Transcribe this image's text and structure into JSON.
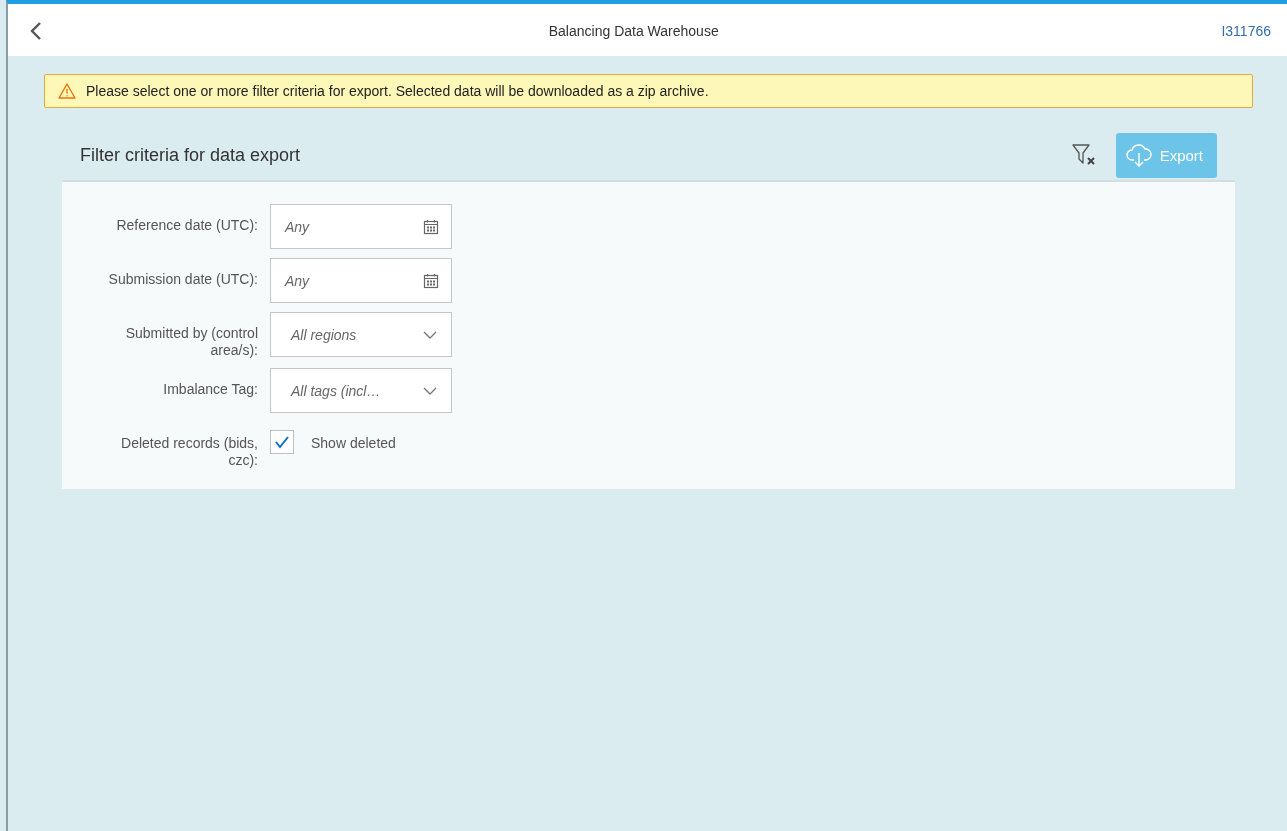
{
  "header": {
    "title": "Balancing Data Warehouse",
    "user": "I311766"
  },
  "message": {
    "kind": "warning",
    "text": "Please select one or more filter criteria for export. Selected data will be downloaded as a zip archive."
  },
  "panel": {
    "title": "Filter criteria for data export",
    "export_button": {
      "label": "Export",
      "disabled": true
    },
    "fields": [
      {
        "kind": "date",
        "label": "Reference date (UTC):",
        "placeholder": "Any"
      },
      {
        "kind": "date",
        "label": "Submission date (UTC):",
        "placeholder": "Any"
      },
      {
        "kind": "select",
        "label": "Submitted by (control area/s):",
        "placeholder": "All regions"
      },
      {
        "kind": "select",
        "label": "Imbalance Tag:",
        "placeholder": "All tags (incl…"
      },
      {
        "kind": "checkbox",
        "label": "Deleted records (bids, czc):",
        "text": "Show deleted",
        "checked": true
      }
    ]
  }
}
